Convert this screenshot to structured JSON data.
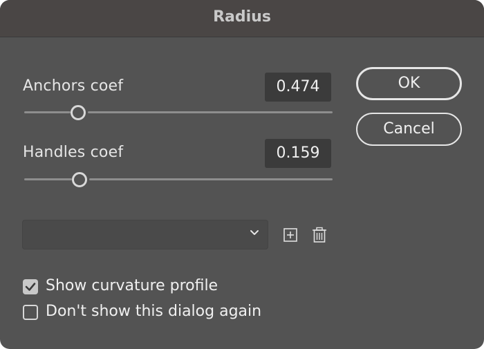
{
  "dialog": {
    "title": "Radius"
  },
  "anchors": {
    "label": "Anchors coef",
    "value": "0.474"
  },
  "handles": {
    "label": "Handles coef",
    "value": "0.159"
  },
  "buttons": {
    "ok_label": "OK",
    "cancel_label": "Cancel"
  },
  "preset": {
    "selected": "",
    "icons": [
      "chevron-down-icon",
      "add-icon",
      "trash-icon"
    ]
  },
  "options": {
    "show_curvature_label": "Show curvature profile",
    "show_curvature_checked": true,
    "dont_show_label": "Don't show this dialog again",
    "dont_show_checked": false
  },
  "colors": {
    "dialog_bg": "#535353",
    "titlebar_bg": "#4a4645",
    "field_bg": "#3b3b3b",
    "text": "#e6e6e6"
  }
}
